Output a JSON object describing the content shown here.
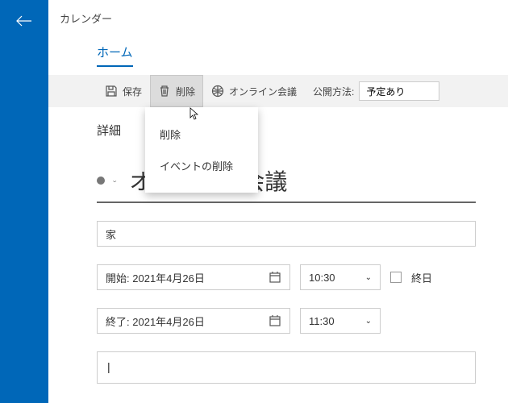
{
  "app_title": "カレンダー",
  "tab_home": "ホーム",
  "toolbar": {
    "save": "保存",
    "delete": "削除",
    "online_meeting": "オンライン会議",
    "pub_method_label": "公開方法:",
    "pub_method_value": "予定あり"
  },
  "delete_menu": {
    "item1": "削除",
    "item2": "イベントの削除"
  },
  "details_header": "詳細",
  "event": {
    "title": "オンライン会議",
    "location": "家",
    "start_label": "開始:",
    "start_date": "2021年4月26日",
    "start_time": "10:30",
    "end_label": "終了:",
    "end_date": "2021年4月26日",
    "end_time": "11:30",
    "allday_label": "終日",
    "description_caret": "|"
  }
}
